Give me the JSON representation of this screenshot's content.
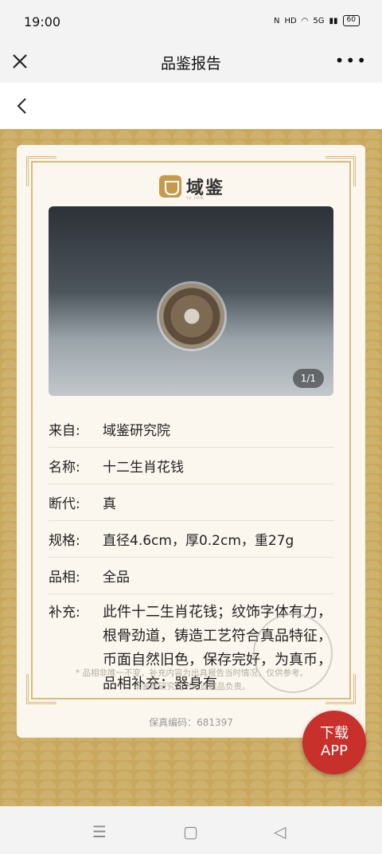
{
  "status_bar": {
    "time": "19:00",
    "network": "5G",
    "battery": "60"
  },
  "title_bar": {
    "title": "品鉴报告",
    "more": "•••"
  },
  "brand": {
    "name": "域鉴",
    "subtitle": "YU JIAN"
  },
  "photo": {
    "counter": "1/1"
  },
  "details": [
    {
      "key": "来自:",
      "value": "域鉴研究院"
    },
    {
      "key": "名称:",
      "value": "十二生肖花钱"
    },
    {
      "key": "断代:",
      "value": "真"
    },
    {
      "key": "规格:",
      "value": "直径4.6cm，厚0.2cm，重27g"
    },
    {
      "key": "品相:",
      "value": "全品"
    },
    {
      "key": "补充:",
      "value": "此件十二生肖花钱；纹饰字体有力，根骨劲道，铸造工艺符合真品特征，币面自然旧色，保存完好，为真币，品相补充：器身有"
    }
  ],
  "note": "* 品相非唯一不变，补充内容为出具报告当时情况，仅供参考。本鉴定研究院不对此藏品负责。",
  "serial": "保真编码：681397",
  "download_button": {
    "line1": "下载",
    "line2": "APP"
  },
  "colors": {
    "gold": "#c9a85d",
    "card": "#fcf7ee",
    "accent": "#c8302c"
  }
}
